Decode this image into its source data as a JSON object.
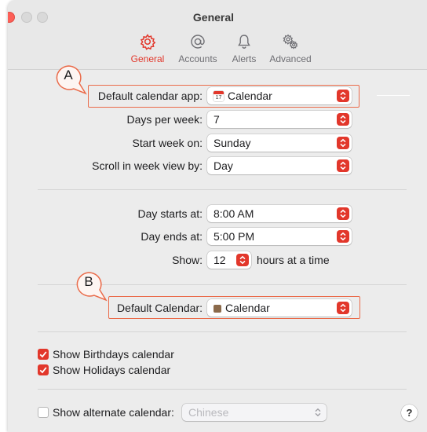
{
  "window": {
    "title": "General"
  },
  "toolbar": {
    "tabs": [
      {
        "label": "General",
        "icon": "gear-icon",
        "active": true
      },
      {
        "label": "Accounts",
        "icon": "at-icon",
        "active": false
      },
      {
        "label": "Alerts",
        "icon": "bell-icon",
        "active": false
      },
      {
        "label": "Advanced",
        "icon": "gears-icon",
        "active": false
      }
    ]
  },
  "callouts": {
    "a": "A",
    "b": "B"
  },
  "settings": {
    "default_app_label": "Default calendar app:",
    "default_app_value": "Calendar",
    "default_app_icon_day": "17",
    "days_per_week_label": "Days per week:",
    "days_per_week_value": "7",
    "start_week_label": "Start week on:",
    "start_week_value": "Sunday",
    "scroll_label": "Scroll in week view by:",
    "scroll_value": "Day",
    "day_starts_label": "Day starts at:",
    "day_starts_value": "8:00 AM",
    "day_ends_label": "Day ends at:",
    "day_ends_value": "5:00 PM",
    "show_label": "Show:",
    "show_value": "12",
    "show_suffix": "hours at a time",
    "default_calendar_label": "Default Calendar:",
    "default_calendar_value": "Calendar"
  },
  "checkboxes": {
    "birthdays": {
      "label": "Show Birthdays calendar",
      "checked": true
    },
    "holidays": {
      "label": "Show Holidays calendar",
      "checked": true
    },
    "alternate": {
      "label": "Show alternate calendar:",
      "checked": false,
      "value": "Chinese"
    }
  },
  "help": {
    "label": "?"
  },
  "colors": {
    "accent": "#e2372b",
    "callout": "#ea6b4a",
    "calendar_swatch": "#8b6a4b"
  }
}
